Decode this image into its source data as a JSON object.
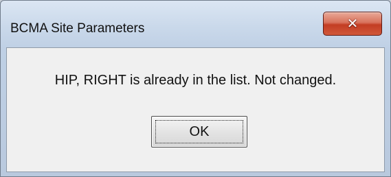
{
  "window": {
    "title": "BCMA Site Parameters",
    "close_icon": "close-icon"
  },
  "dialog": {
    "message": "HIP, RIGHT is already in the list. Not changed.",
    "ok_label": "OK"
  },
  "colors": {
    "close_button": "#c33d23",
    "client_background": "#f0f0f0",
    "frame": "#c9d8ea"
  }
}
